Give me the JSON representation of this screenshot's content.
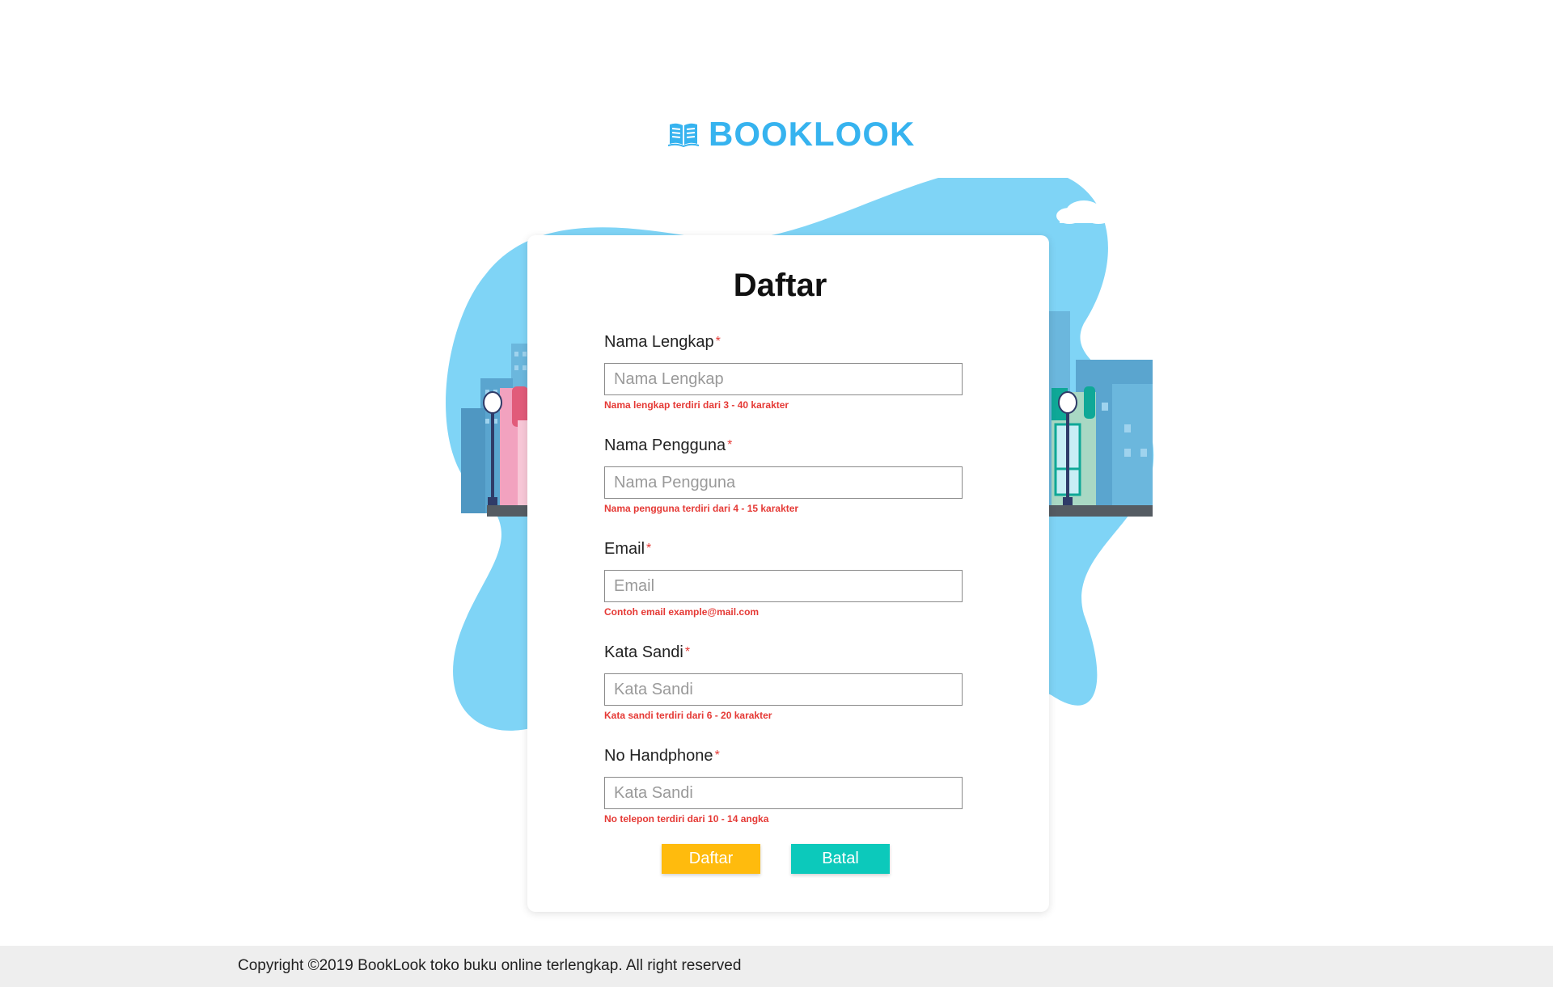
{
  "brand": {
    "name": "BOOKLOOK",
    "icon": "book-open-icon",
    "color": "#36b3ef"
  },
  "form": {
    "title": "Daftar",
    "required_marker": "*",
    "fields": [
      {
        "label": "Nama Lengkap",
        "placeholder": "Nama Lengkap",
        "value": "",
        "hint": "Nama lengkap terdiri dari 3 - 40 karakter"
      },
      {
        "label": "Nama Pengguna",
        "placeholder": "Nama Pengguna",
        "value": "",
        "hint": "Nama pengguna terdiri dari 4 - 15 karakter"
      },
      {
        "label": "Email",
        "placeholder": "Email",
        "value": "",
        "hint": "Contoh email example@mail.com"
      },
      {
        "label": "Kata Sandi",
        "placeholder": "Kata Sandi",
        "value": "",
        "hint": "Kata sandi terdiri dari 6 - 20 karakter"
      },
      {
        "label": "No Handphone",
        "placeholder": "Kata Sandi",
        "value": "",
        "hint": "No telepon terdiri dari 10 - 14 angka"
      }
    ],
    "submit_label": "Daftar",
    "cancel_label": "Batal"
  },
  "colors": {
    "hint": "#e53935",
    "submit": "#ffbb0d",
    "cancel": "#0cc9bb",
    "blob": "#7fd4f6"
  },
  "footer": {
    "copyright": "Copyright ©2019 BookLook toko buku online terlengkap. All right reserved"
  }
}
